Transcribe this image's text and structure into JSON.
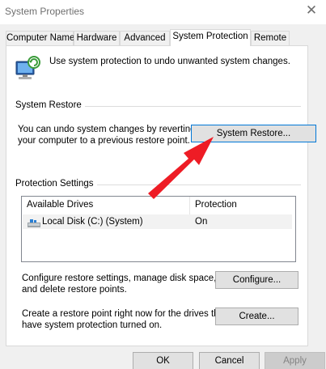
{
  "window": {
    "title": "System Properties"
  },
  "tabs": [
    "Computer Name",
    "Hardware",
    "Advanced",
    "System Protection",
    "Remote"
  ],
  "intro": {
    "text": "Use system protection to undo unwanted system changes."
  },
  "system_restore": {
    "group_label": "System Restore",
    "description_line1": "You can undo system changes by reverting",
    "description_line2": "your computer to a previous restore point.",
    "button_label": "System Restore..."
  },
  "protection": {
    "group_label": "Protection Settings",
    "columns": [
      "Available Drives",
      "Protection"
    ],
    "rows": [
      {
        "drive": "Local Disk (C:) (System)",
        "protection": "On"
      }
    ]
  },
  "configure": {
    "line1": "Configure restore settings, manage disk space,",
    "line2": "and delete restore points.",
    "button_label": "Configure..."
  },
  "create": {
    "line1": "Create a restore point right now for the drives that",
    "line2": "have system protection turned on.",
    "button_label": "Create..."
  },
  "footer": {
    "ok_label": "OK",
    "cancel_label": "Cancel",
    "apply_label": "Apply"
  },
  "colors": {
    "annotation_arrow": "#ee1c25",
    "focus_border": "#0078d7"
  }
}
